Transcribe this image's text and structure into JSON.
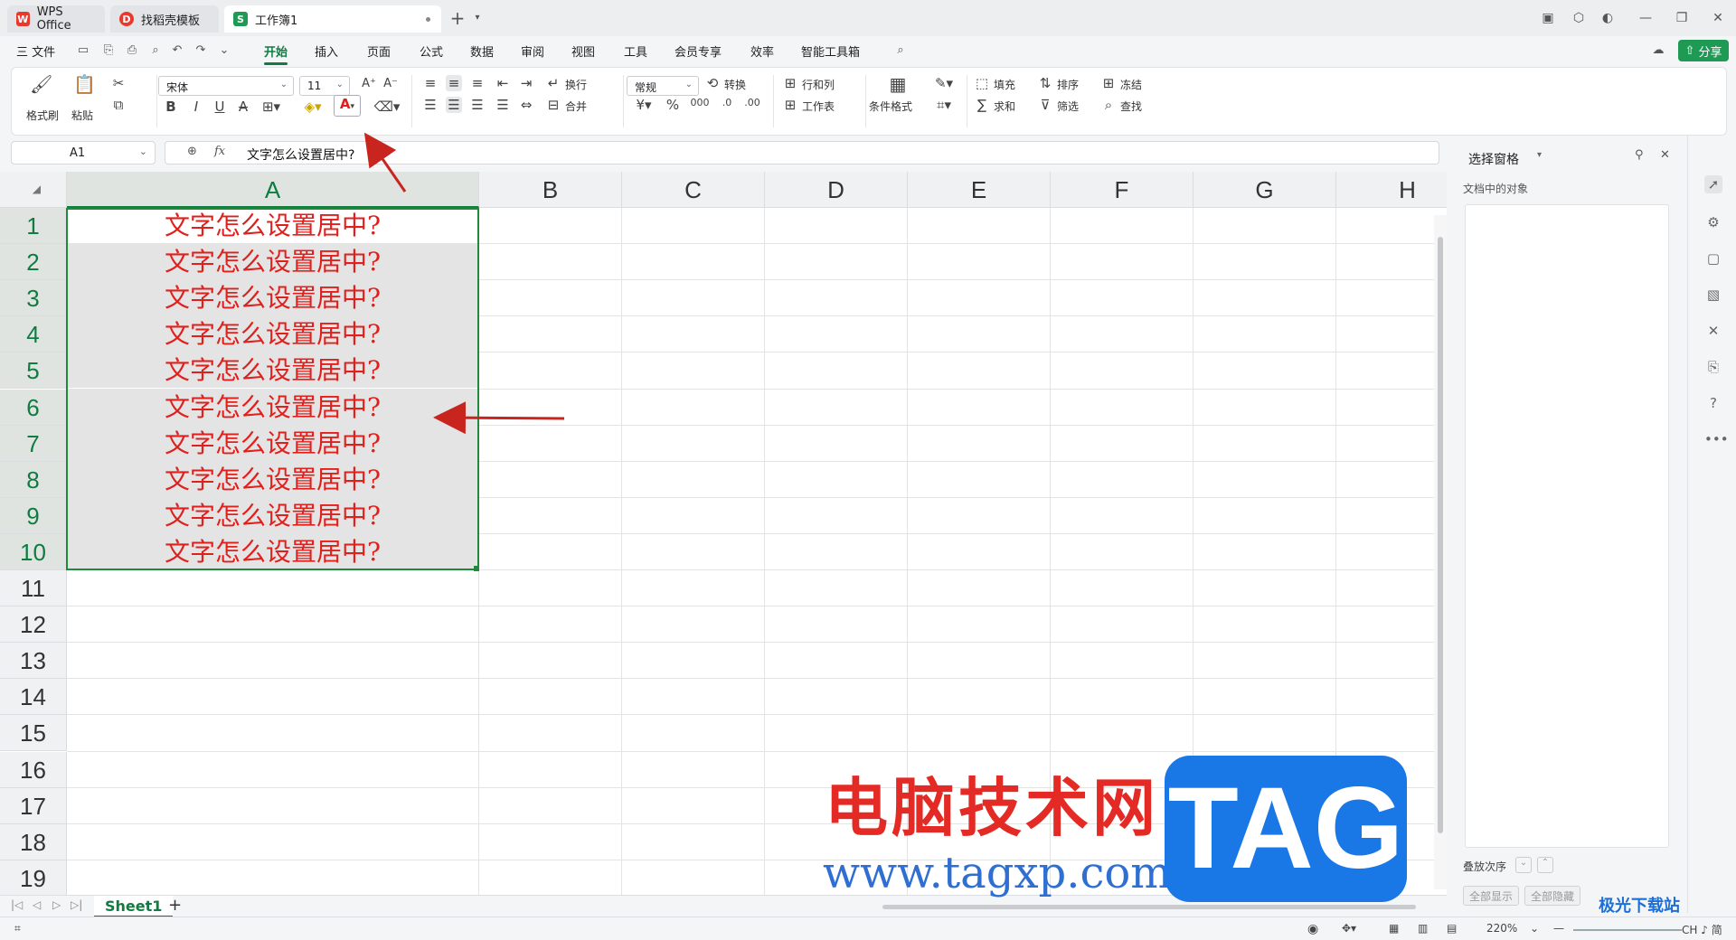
{
  "colors": {
    "accent": "#107c41",
    "share": "#1e9a54",
    "cell_text": "#e0201c",
    "arrow": "#c8251f"
  },
  "tabs": [
    {
      "label": "WPS Office",
      "icon": "wps-logo-icon"
    },
    {
      "label": "找稻壳模板",
      "icon": "docer-logo-icon"
    },
    {
      "label": "工作簿1",
      "icon": "sheet-logo-icon"
    }
  ],
  "menu": {
    "file": "三 文件",
    "items": [
      "开始",
      "插入",
      "页面",
      "公式",
      "数据",
      "审阅",
      "视图",
      "工具",
      "会员专享",
      "效率",
      "智能工具箱"
    ],
    "active": "开始",
    "share": "分享"
  },
  "ribbon": {
    "format_painter": "格式刷",
    "paste": "粘贴",
    "font_name": "宋体",
    "font_size": "11",
    "wrap": "换行",
    "merge": "合并",
    "number_format": "常规",
    "convert": "转换",
    "rows_cols": "行和列",
    "worksheet": "工作表",
    "cond_format": "条件格式",
    "fill": "填充",
    "sort": "排序",
    "freeze": "冻结",
    "sum": "求和",
    "filter": "筛选",
    "find": "查找"
  },
  "formula_bar": {
    "cell_ref": "A1",
    "fx": "fx",
    "content": "文字怎么设置居中?"
  },
  "columns": [
    "A",
    "B",
    "C",
    "D",
    "E",
    "F",
    "G",
    "H"
  ],
  "rows": [
    "1",
    "2",
    "3",
    "4",
    "5",
    "6",
    "7",
    "8",
    "9",
    "10",
    "11",
    "12",
    "13",
    "14",
    "15",
    "16",
    "17",
    "18",
    "19"
  ],
  "cells_A": [
    "文字怎么设置居中?",
    "文字怎么设置居中?",
    "文字怎么设置居中?",
    "文字怎么设置居中?",
    "文字怎么设置居中?",
    "文字怎么设置居中?",
    "文字怎么设置居中?",
    "文字怎么设置居中?",
    "文字怎么设置居中?",
    "文字怎么设置居中?"
  ],
  "sheet": {
    "name": "Sheet1",
    "add": "+"
  },
  "status": {
    "zoom": "220%",
    "lang": "CH ♪ 简"
  },
  "panel": {
    "title": "选择窗格",
    "subtitle": "文档中的对象",
    "order": "叠放次序",
    "show_all": "全部显示",
    "hide_all": "全部隐藏"
  },
  "watermark": {
    "cn": "电脑技术网",
    "url": "www.tagxp.com",
    "tag": "TAG",
    "jg": "极光下载站"
  }
}
